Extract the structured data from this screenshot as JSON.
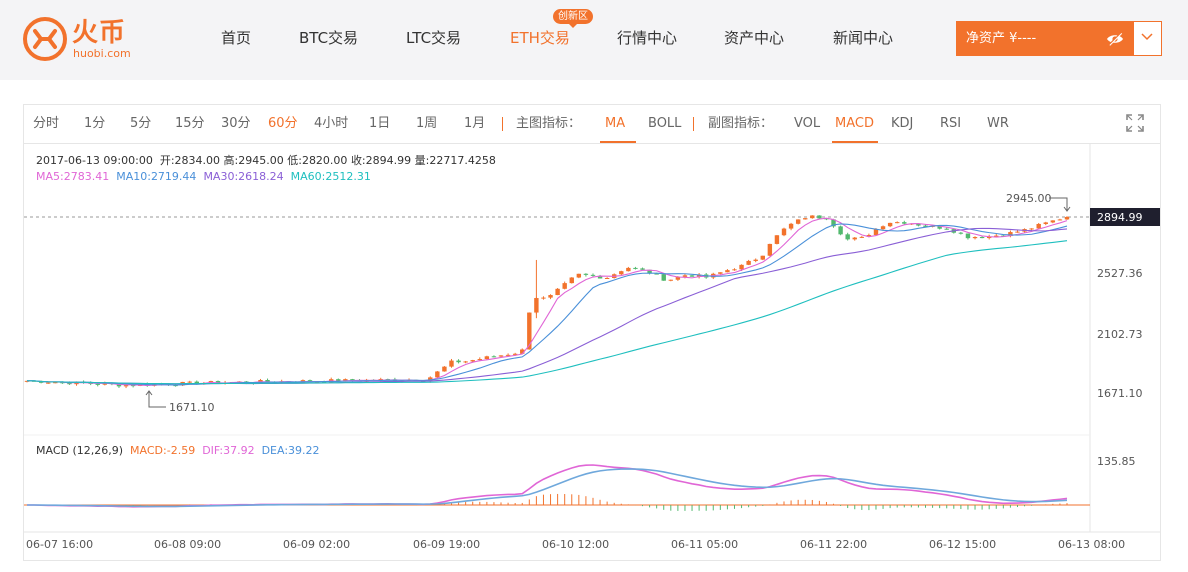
{
  "header": {
    "logo_cn": "火币",
    "logo_en": "huobi.com",
    "nav": [
      {
        "label": "首页"
      },
      {
        "label": "BTC交易"
      },
      {
        "label": "LTC交易"
      },
      {
        "label": "ETH交易"
      },
      {
        "label": "行情中心"
      },
      {
        "label": "资产中心"
      },
      {
        "label": "新闻中心"
      }
    ],
    "active_nav": "ETH交易",
    "badge": "创新区",
    "asset_label": "净资产 ¥----",
    "accent": "#f2722c"
  },
  "toolbar": {
    "periods": [
      "分时",
      "1分",
      "5分",
      "15分",
      "30分",
      "60分",
      "4小时",
      "1日",
      "1周",
      "1月"
    ],
    "active_period": "60分",
    "main_label": "主图指标：",
    "main_indicators": [
      "MA",
      "BOLL"
    ],
    "active_main": "MA",
    "sub_label": "副图指标：",
    "sub_indicators": [
      "VOL",
      "MACD",
      "KDJ",
      "RSI",
      "WR"
    ],
    "active_sub": "MACD",
    "fullscreen_icon": "fullscreen-icon"
  },
  "info": {
    "datetime": "2017-06-13 09:00:00",
    "open": "开:2834.00",
    "high": "高:2945.00",
    "low": "低:2820.00",
    "close": "收:2894.99",
    "volume": "量:22717.4258",
    "ma5": "MA5:2783.41",
    "ma10": "MA10:2719.44",
    "ma30": "MA30:2618.24",
    "ma60": "MA60:2512.31",
    "macd_title": "MACD (12,26,9)",
    "macd": "MACD:-2.59",
    "dif": "DIF:37.92",
    "dea": "DEA:39.22"
  },
  "chart_data": {
    "type": "candlestick",
    "y_ticks": [
      "2527.36",
      "2102.73",
      "1671.10"
    ],
    "macd_tick": "135.85",
    "x_ticks": [
      "06-07 16:00",
      "06-08 09:00",
      "06-09 02:00",
      "06-09 19:00",
      "06-10 12:00",
      "06-11 05:00",
      "06-11 22:00",
      "06-12 15:00",
      "06-13 08:00"
    ],
    "current_price": "2894.99",
    "high_annotation": "2945.00",
    "low_annotation": "1671.10",
    "ylim": [
      1500,
      3060
    ],
    "colors": {
      "up": "#f2722c",
      "down": "#52b96e",
      "ma5": "#e066d6",
      "ma10": "#4a90d9",
      "ma30": "#8a5fd6",
      "ma60": "#1fbfbf",
      "dif": "#e066d6",
      "dea": "#6fa8dc"
    }
  }
}
